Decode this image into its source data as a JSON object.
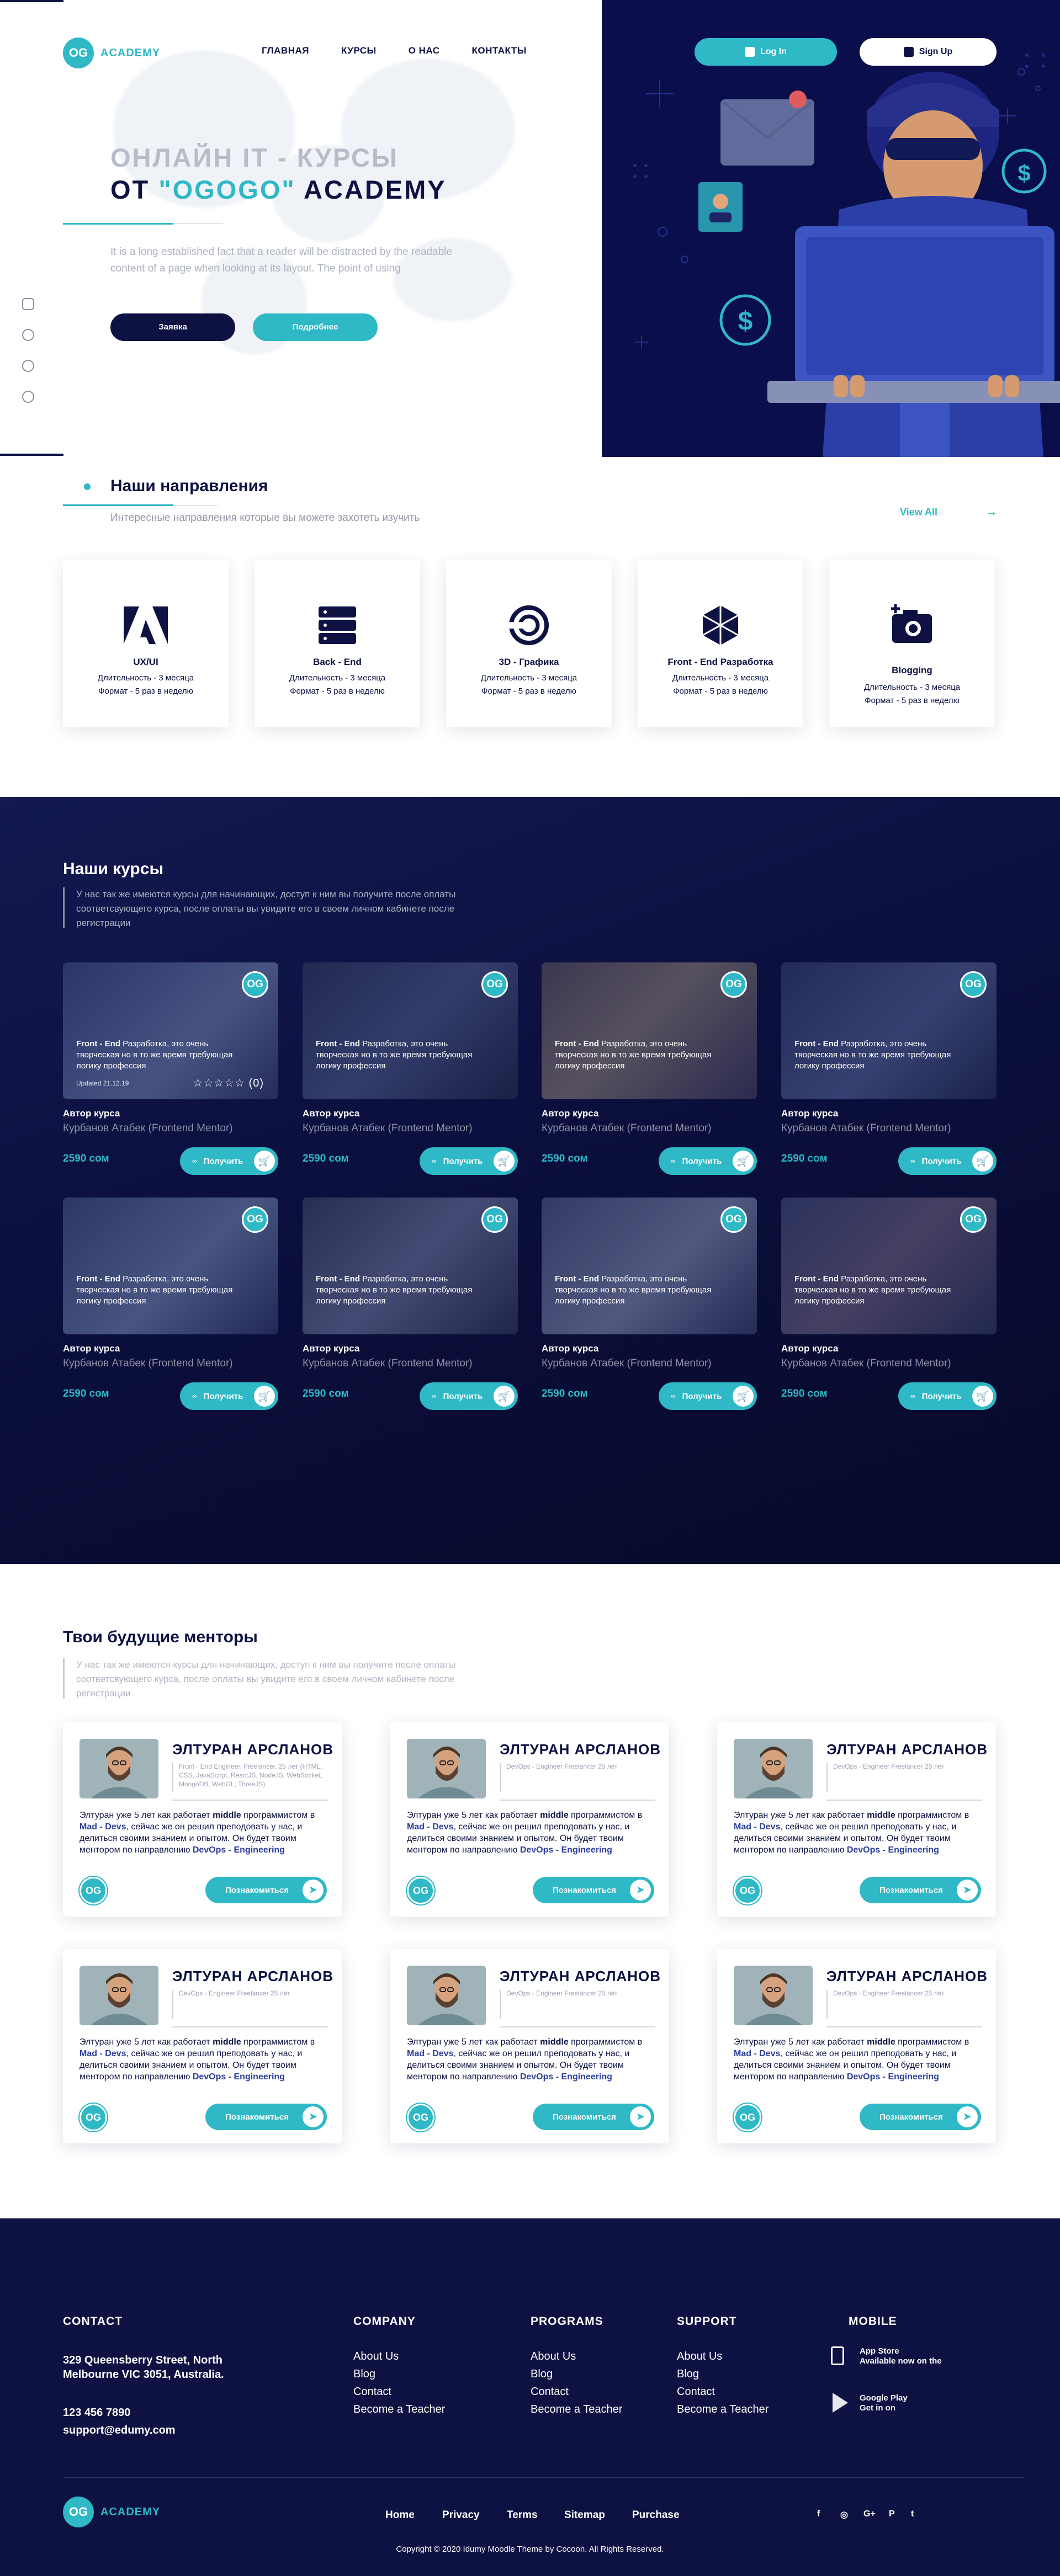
{
  "brand": {
    "logo_mark": "OG",
    "name": "ACADEMY",
    "accent": "#2fb8c6",
    "dark": "#0d1242"
  },
  "nav": {
    "items": [
      "ГЛАВНАЯ",
      "КУРСЫ",
      "О НАС",
      "КОНТАКТЫ"
    ]
  },
  "auth": {
    "login": "Log In",
    "signup": "Sign Up"
  },
  "hero": {
    "title_line1": "ОНЛАЙН IT - КУРСЫ",
    "title_prefix": "ОТ ",
    "title_accent": "\"OGOGO\"",
    "title_suffix": " ACADEMY",
    "description": "It is a long established fact that a reader will be distracted by the readable content of a page when looking at its layout. The point of using",
    "btn_request": "Заявка",
    "btn_more": "Подробнее",
    "socials": [
      "instagram-icon",
      "facebook-icon",
      "whatsapp-icon",
      "telegram-icon"
    ]
  },
  "directions": {
    "title": "Наши направления",
    "subtitle": "Интересные направления которые вы можете захотеть изучить",
    "view_all": "View All",
    "items": [
      {
        "title": "UX/UI",
        "duration": "Длительность - 3 месяца",
        "format": "Формат - 5 раз в неделю",
        "icon": "adobe-icon"
      },
      {
        "title": "Back - End",
        "duration": "Длительность - 3 месяца",
        "format": "Формат - 5 раз в неделю",
        "icon": "server-icon"
      },
      {
        "title": "3D - Графика",
        "duration": "Длительность - 3 месяца",
        "format": "Формат - 5 раз в неделю",
        "icon": "swirl-icon"
      },
      {
        "title": "Front - End Разработка",
        "duration": "Длительность - 3 месяца",
        "format": "Формат - 5 раз в неделю",
        "icon": "cube-icon"
      },
      {
        "title": "Blogging",
        "duration": "Длительность - 3 месяца",
        "format": "Формат - 5 раз в неделю",
        "icon": "camera-icon"
      }
    ]
  },
  "courses": {
    "title": "Наши курсы",
    "description": "У нас так же имеются курсы для начинающих, доступ к ним вы получите после оплаты соответсвующего курса, после оплаты вы увидите его в своем личном кабинете после регистрации",
    "caption_bold": "Front - End",
    "caption_rest": " Разработка, это очень творческая но в то же время требующая логику профессия",
    "updated": "Updated 21.12.19",
    "stars": "☆☆☆☆☆",
    "rating_count": "(0)",
    "author_label": "Автор курса",
    "mentor": "Курбанов Атабек (Frontend Mentor)",
    "price": "2590 сом",
    "btn": "Получить",
    "cards": [
      {
        "bg": "linear-gradient(135deg,#3a4a82,#6f7fa8 60%,#2d3566)"
      },
      {
        "bg": "linear-gradient(135deg,#2a3356,#4a5680 50%,#1b2140)"
      },
      {
        "bg": "linear-gradient(135deg,#5a4b52,#8a7b6b 45%,#3b3550)"
      },
      {
        "bg": "linear-gradient(135deg,#2b3460,#515d8c 55%,#1d2448)"
      },
      {
        "bg": "linear-gradient(135deg,#3c4b78,#7181a8 55%,#2b3260)"
      },
      {
        "bg": "linear-gradient(135deg,#343b54,#6a7092 50%,#262c46)"
      },
      {
        "bg": "linear-gradient(135deg,#4a5275,#8088a8 55%,#30375a)"
      },
      {
        "bg": "linear-gradient(135deg,#3a4368,#6b5a72 50%,#29304f)"
      }
    ]
  },
  "mentors": {
    "title": "Твои будущие менторы",
    "description": "У нас так же имеются курсы для начинающих, доступ к ним вы получите после оплаты соответсвующего курса, после оплаты вы увидите его в своем личном кабинете после регистрации",
    "name": "ЭЛТУРАН АРСЛАНОВ",
    "tags_first": "Front - End Engineer, Freelancer, 25 лет (HTML, CSS, JavaScript, ReactJS, NodeJS, WebSocket, MongoDB, WebGL, ThreeJS)",
    "tags_other": "DevOps - Engineer Freelancer 25 лет",
    "desc_1": "Элтуран уже 5 лет как  работает ",
    "desc_middle": "middle",
    "desc_2": " программистом в ",
    "desc_mad": "Mad - Devs",
    "desc_3": ", сейчас же он решил преподовать у нас, и делиться своими знанием и опытом. Он будет твоим ментором по направлению ",
    "desc_dev": "DevOps - Engineering",
    "btn": "Познакомиться",
    "logo": "OG"
  },
  "footer": {
    "contact_title": "CONTACT",
    "address": "329 Queensberry Street, North Melbourne VIC 3051, Australia.",
    "phone": "123 456 7890",
    "email": "support@edumy.com",
    "company_title": "COMPANY",
    "company": [
      "About Us",
      "Blog",
      "Contact",
      "Become a Teacher"
    ],
    "programs_title": "PROGRAMS",
    "programs": [
      "About Us",
      "Blog",
      "Contact",
      "Become a Teacher"
    ],
    "support_title": "SUPPORT",
    "support": [
      "About Us",
      "Blog",
      "Contact",
      "Become a Teacher"
    ],
    "mobile_title": "MOBILE",
    "appstore_line1": "App Store",
    "appstore_line2": "Available now on the",
    "googleplay_line1": "Google Play",
    "googleplay_line2": "Get in on",
    "bottom_nav": [
      "Home",
      "Privacy",
      "Terms",
      "Sitemap",
      "Purchase"
    ],
    "copyright": "Copyright © 2020 Idumy Moodle Theme by Cocoon. All Rights Reserved.",
    "social": [
      "f",
      "◎",
      "G+",
      "P",
      "t"
    ]
  }
}
